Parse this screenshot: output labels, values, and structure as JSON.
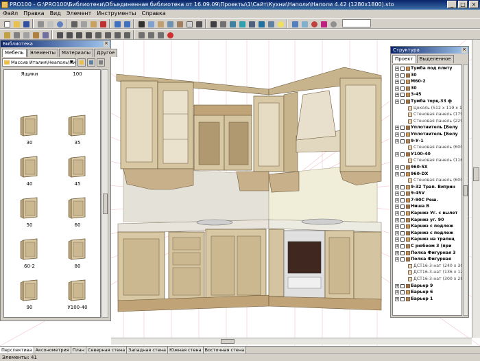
{
  "window": {
    "title": "PRO100 - G:\\PRO100\\Библиотеки\\Объединенная библиотека от 16.09.09\\Проекты\\1\\Сайт\\Кухни\\Наполи\\Наполи 4.42 (1280x1800).sto"
  },
  "menu": [
    "Файл",
    "Правка",
    "Вид",
    "Элемент",
    "Инструменты",
    "Справка"
  ],
  "library": {
    "title": "Библиотека",
    "tabs": [
      "Мебель",
      "Элементы",
      "Материалы",
      "Другое"
    ],
    "active_tab": 0,
    "folder": "Массив Италия\\Неаполь\\Низ",
    "items": [
      {
        "label": "Ящики"
      },
      {
        "label": "100"
      },
      {
        "label": "30"
      },
      {
        "label": "35"
      },
      {
        "label": "40"
      },
      {
        "label": "45"
      },
      {
        "label": "50"
      },
      {
        "label": "60"
      },
      {
        "label": "60-2"
      },
      {
        "label": "80"
      },
      {
        "label": "90"
      },
      {
        "label": "У100-40"
      }
    ]
  },
  "structure": {
    "title": "Структура",
    "tabs": [
      "Проект",
      "Выделенное"
    ],
    "active_tab": 0,
    "rows": [
      {
        "text": "Тумба под плиту",
        "kind": "item"
      },
      {
        "text": "30",
        "kind": "item"
      },
      {
        "text": "М60-2",
        "kind": "item"
      },
      {
        "text": "30",
        "kind": "item"
      },
      {
        "text": "3-45",
        "kind": "item"
      },
      {
        "text": "Тумба торц.33 ф",
        "kind": "item"
      },
      {
        "text": "Цоколь  (512 x 119 x 1",
        "kind": "panel"
      },
      {
        "text": "Стеновая панель  (179",
        "kind": "panel"
      },
      {
        "text": "Стеновая панель  (229",
        "kind": "panel"
      },
      {
        "text": "Уплотнитель  [Белу",
        "kind": "item"
      },
      {
        "text": "Уплотнитель  [Белу",
        "kind": "item"
      },
      {
        "text": "9-У-1",
        "kind": "item"
      },
      {
        "text": "Стеновая панель  (600",
        "kind": "panel"
      },
      {
        "text": "У100-40",
        "kind": "item"
      },
      {
        "text": "Стеновая панель  (116",
        "kind": "panel"
      },
      {
        "text": "960-5Х",
        "kind": "item"
      },
      {
        "text": "960-DX",
        "kind": "item"
      },
      {
        "text": "Стеновая панель  (600",
        "kind": "panel"
      },
      {
        "text": "9-32 Трап. Витрин",
        "kind": "item"
      },
      {
        "text": "9-45V",
        "kind": "item"
      },
      {
        "text": "7-90С Реш.",
        "kind": "item"
      },
      {
        "text": "Ниша В",
        "kind": "item"
      },
      {
        "text": "Карниз Уг. с вылет",
        "kind": "item"
      },
      {
        "text": "Карниз уг. 90",
        "kind": "item"
      },
      {
        "text": "Карниз с подлож",
        "kind": "item"
      },
      {
        "text": "Карниз с подлож",
        "kind": "item"
      },
      {
        "text": "Карниз на трапец",
        "kind": "item"
      },
      {
        "text": "С рюбеом 3 (при",
        "kind": "item"
      },
      {
        "text": "Полка Фигурная 3",
        "kind": "item"
      },
      {
        "text": "Полка Фигурная",
        "kind": "item"
      },
      {
        "text": "ДСТ16-3-нат  (240 x 30",
        "kind": "panel"
      },
      {
        "text": "ДСТ16-3-нат  (136 x 12",
        "kind": "panel"
      },
      {
        "text": "ДСТ16-3-нат  (300 x 28",
        "kind": "panel"
      },
      {
        "text": "Барьер 9",
        "kind": "item"
      },
      {
        "text": "Барьер 6",
        "kind": "item"
      },
      {
        "text": "Барьер 1",
        "kind": "item"
      }
    ]
  },
  "view_tabs": [
    "Перспектива",
    "Аксонометрия",
    "План",
    "Северная стена",
    "Западная стена",
    "Южная стена",
    "Восточная стена"
  ],
  "active_view": 0,
  "status": {
    "elements": "Элементы: 41"
  },
  "colors": {
    "title_bar": "#0a246a",
    "wood": "#d8c8a4",
    "wood_dark": "#b8a27a",
    "counter": "#e8e4dc",
    "grid": "#f0b8c0"
  }
}
